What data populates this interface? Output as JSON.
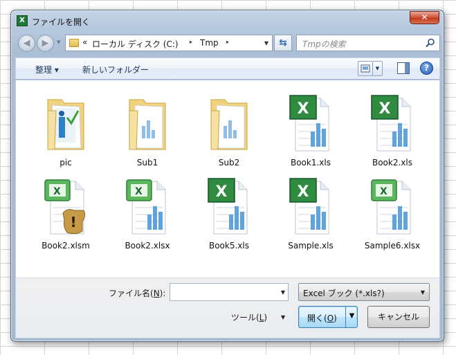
{
  "window": {
    "title": "ファイルを開く",
    "app_icon_letter": "X",
    "close_glyph": "✕"
  },
  "navigation": {
    "back_glyph": "◀",
    "forward_glyph": "▶",
    "address": {
      "overflow": "«",
      "segments": [
        "ローカル ディスク (C:)",
        "Tmp"
      ],
      "separator_glyph": "▸",
      "dropdown_glyph": "▼"
    },
    "refresh_glyph": "⇆",
    "search": {
      "placeholder": "Tmpの検索"
    }
  },
  "toolbar": {
    "organize_label": "整理 ▾",
    "new_folder_label": "新しいフォルダー",
    "view_drop_glyph": "▼",
    "help_glyph": "?"
  },
  "files": [
    {
      "name": "pic",
      "kind": "folder-pic"
    },
    {
      "name": "Sub1",
      "kind": "folder"
    },
    {
      "name": "Sub2",
      "kind": "folder"
    },
    {
      "name": "Book1.xls",
      "kind": "xls"
    },
    {
      "name": "Book2.xls",
      "kind": "xls"
    },
    {
      "name": "Book2.xlsm",
      "kind": "xlsm"
    },
    {
      "name": "Book2.xlsx",
      "kind": "xlsx"
    },
    {
      "name": "Book5.xls",
      "kind": "xls"
    },
    {
      "name": "Sample.xls",
      "kind": "xls"
    },
    {
      "name": "Sample6.xlsx",
      "kind": "xlsx"
    }
  ],
  "bottom": {
    "filename_label_pre": "ファイル名(",
    "filename_label_key": "N",
    "filename_label_post": "):",
    "filename_value": "",
    "filename_drop_glyph": "▼",
    "filter_value": "Excel ブック (*.xls?)",
    "filter_drop_glyph": "▼",
    "tools_label_pre": "ツール(",
    "tools_label_key": "L",
    "tools_label_post": ")",
    "tools_drop_glyph": "▼",
    "open_label_pre": "開く(",
    "open_label_key": "O",
    "open_label_post": ")",
    "open_split_glyph": "▼",
    "cancel_label": "キャンセル"
  },
  "colors": {
    "accent": "#3c7fb1",
    "excel_green": "#2e8b3f",
    "folder_yellow": "#f2d27a",
    "chart_blue": "#5fa3e0"
  }
}
